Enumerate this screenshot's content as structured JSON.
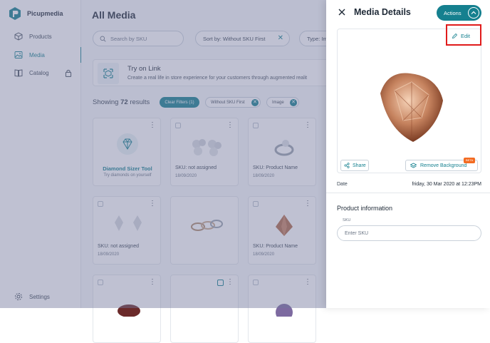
{
  "sidebar": {
    "brand": "Picupmedia",
    "items": [
      {
        "label": "Products"
      },
      {
        "label": "Media"
      },
      {
        "label": "Catalog"
      }
    ],
    "settings_label": "Settings"
  },
  "main": {
    "title": "All Media",
    "search_placeholder": "Search by SKU",
    "sort_label": "Sort by: Without SKU First",
    "type_label": "Type: Im",
    "banner": {
      "title": "Try on Link",
      "subtitle": "Create a real life in store experience for your customers through augmented realit"
    },
    "results_prefix": "Showing",
    "results_count": "72",
    "results_suffix": "results",
    "clear_filters": "Clear Filters (1)",
    "chips": [
      "Without SKU First",
      "Image"
    ],
    "cards": [
      {
        "title": "Diamond Sizer Tool",
        "subtitle": "Try diamonds on yourself"
      },
      {
        "caption": "SKU: not assigned",
        "date": "18/09/2020"
      },
      {
        "caption": "SKU: Product Name",
        "date": "18/09/2020"
      },
      {
        "caption": "SKU: not assigned",
        "date": "18/09/2020"
      },
      {
        "caption": "",
        "date": ""
      },
      {
        "caption": "SKU: Product Name",
        "date": "18/09/2020"
      }
    ]
  },
  "drawer": {
    "title": "Media Details",
    "actions_label": "Actions",
    "edit_label": "Edit",
    "share_label": "Share",
    "remove_bg_label": "Remove Background",
    "beta_label": "BETA",
    "date_label": "Date",
    "date_value": "friday, 30 Mar 2020 at 12:23PM",
    "product_info_title": "Product information",
    "sku_label": "SKU",
    "sku_placeholder": "Enter SKU"
  },
  "colors": {
    "accent": "#15808f",
    "highlight": "#e01b1b",
    "beta": "#f36b21",
    "overlay": "#70769b"
  }
}
